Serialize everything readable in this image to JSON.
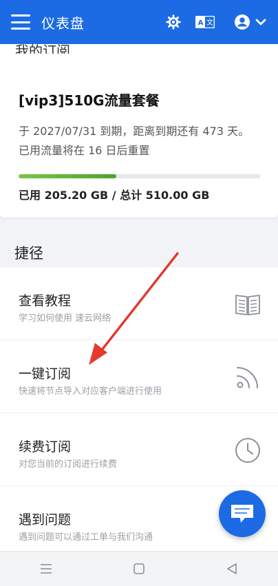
{
  "appbar": {
    "title": "仪表盘",
    "icons": [
      "menu-icon",
      "settings-icon",
      "translate-icon",
      "account-icon",
      "chevron-down-icon"
    ],
    "color": "#1c6be4"
  },
  "subscription": {
    "section_title": "我的订阅",
    "plan_name": "[vip3]510G流量套餐",
    "expiry_text": "于 2027/07/31 到期，距离到期还有 473 天。",
    "reset_text": "已用流量将在 16 日后重置",
    "usage_text": "已用 205.20 GB / 总计 510.00 GB",
    "used_fraction": 0.402
  },
  "shortcuts": {
    "title": "捷径",
    "items": [
      {
        "title": "查看教程",
        "subtitle": "学习如何使用 速云网络",
        "icon": "book-icon"
      },
      {
        "title": "一键订阅",
        "subtitle": "快速将节点导入对应客户端进行使用",
        "icon": "rss-icon"
      },
      {
        "title": "续费订阅",
        "subtitle": "对您当前的订阅进行续费",
        "icon": "clock-icon"
      },
      {
        "title": "遇到问题",
        "subtitle": "遇到问题可以通过工单与我们沟通",
        "icon": "chat-icon"
      }
    ]
  },
  "navbar": {
    "icons": [
      "recents-icon",
      "home-icon",
      "back-icon"
    ]
  },
  "annotation": {
    "arrow_color": "#e23b2e"
  }
}
